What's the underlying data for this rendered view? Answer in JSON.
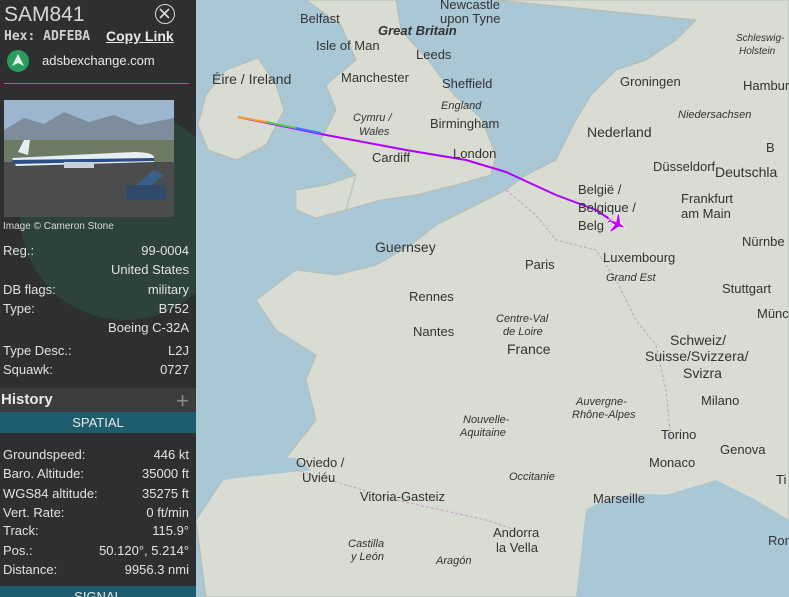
{
  "aircraft": {
    "callsign": "SAM841",
    "hex_label": "Hex:",
    "hex": "ADFEBA",
    "copy_link": "Copy Link",
    "site": "adsbexchange.com",
    "photo_credit": "Image © Cameron Stone"
  },
  "details": [
    {
      "label": "Reg.:",
      "value": "99-0004"
    },
    {
      "label": "",
      "value": "United States"
    },
    {
      "label": "DB flags:",
      "value": "military"
    },
    {
      "label": "Type:",
      "value": "B752"
    },
    {
      "label": "",
      "value": "Boeing C-32A"
    },
    {
      "label": "Type Desc.:",
      "value": "L2J"
    },
    {
      "label": "Squawk:",
      "value": "0727"
    }
  ],
  "history": {
    "label": "History",
    "add_icon": "plus-icon"
  },
  "spatial": {
    "header": "SPATIAL",
    "rows": [
      {
        "label": "Groundspeed:",
        "value": "446 kt"
      },
      {
        "label": "Baro. Altitude:",
        "value": "35000 ft"
      },
      {
        "label": "WGS84 altitude:",
        "value": "35275 ft"
      },
      {
        "label": "Vert. Rate:",
        "value": "0 ft/min"
      },
      {
        "label": "Track:",
        "value": "115.9°"
      },
      {
        "label": "Pos.:",
        "value": "50.120°, 5.214°"
      },
      {
        "label": "Distance:",
        "value": "9956.3 nmi"
      }
    ]
  },
  "signal": {
    "header": "SIGNAL"
  },
  "map": {
    "labels": {
      "belfast": "Belfast",
      "newcastle": "Newcastle",
      "upon_tyne": "upon Tyne",
      "great_britain": "Great Britain",
      "isle_of_man": "Isle of Man",
      "leeds": "Leeds",
      "eire": "Éire / Ireland",
      "manchester": "Manchester",
      "sheffield": "Sheffield",
      "england": "England",
      "cymru": "Cymru /",
      "wales": "Wales",
      "birmingham": "Birmingham",
      "london": "London",
      "cardiff": "Cardiff",
      "guernsey": "Guernsey",
      "schleswig": "Schleswig-",
      "holstein": "Holstein",
      "hamburg": "Hamburg",
      "groningen": "Groningen",
      "niedersachsen": "Niedersachsen",
      "nederland": "Nederland",
      "berlin_part": "B",
      "dusseldorf": "Düsseldorf",
      "deutschland": "Deutschla",
      "belgie1": "België /",
      "belgie2": "Belgique /",
      "belgie3": "Belg",
      "frankfurt": "Frankfurt",
      "am_main": "am Main",
      "luxembourg": "Luxembourg",
      "nurnberg": "Nürnbe",
      "paris": "Paris",
      "grand_est": "Grand Est",
      "rennes": "Rennes",
      "stuttgart": "Stuttgart",
      "munchen": "Münc",
      "nantes": "Nantes",
      "centre_val": "Centre-Val",
      "de_loire": "de Loire",
      "france": "France",
      "schweiz": "Schweiz/",
      "suisse": "Suisse/Svizzera/",
      "svizra": "Svizra",
      "auvergne": "Auvergne-",
      "rhone_alpes": "Rhône-Alpes",
      "milano": "Milano",
      "nouvelle": "Nouvelle-",
      "aquitaine": "Aquitaine",
      "torino": "Torino",
      "oviedo": "Oviedo /",
      "uviéu": "Uviéu",
      "occitanie": "Occitanie",
      "monaco": "Monaco",
      "genova": "Genova",
      "marseille": "Marseille",
      "vitoria": "Vitoria-Gasteiz",
      "andorra": "Andorra",
      "la_vella": "la Vella",
      "castilla": "Castilla",
      "y_leon": "y León",
      "aragon": "Aragón",
      "roma_part": "Rom",
      "it_part": "Ti"
    },
    "colors": {
      "sea": "#a9c7d4",
      "land": "#d9dcd2",
      "track": "#b000ff",
      "aircraft": "#c300ff"
    }
  }
}
